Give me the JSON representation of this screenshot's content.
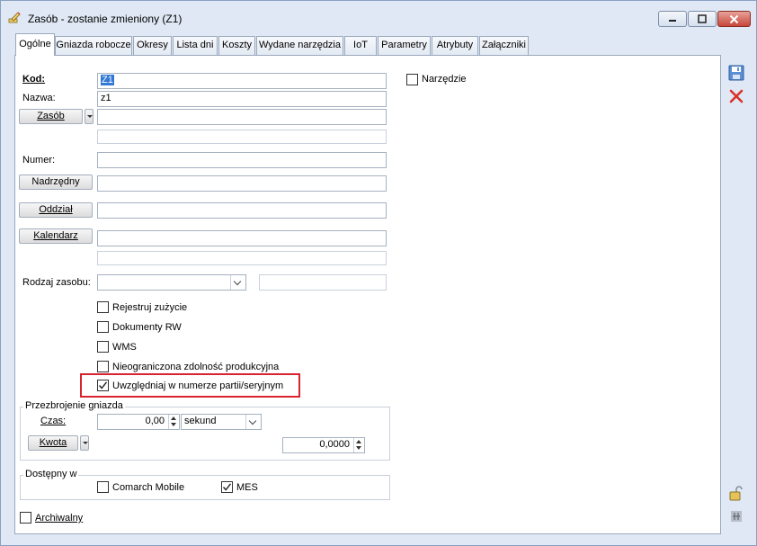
{
  "window": {
    "title": "Zasób - zostanie zmieniony  (Z1)",
    "minimize_glyph": "▬",
    "maximize_glyph": "□",
    "close_glyph": "✕"
  },
  "tabs": [
    {
      "label": "Ogólne"
    },
    {
      "label": "Gniazda robocze"
    },
    {
      "label": "Okresy"
    },
    {
      "label": "Lista dni"
    },
    {
      "label": "Koszty"
    },
    {
      "label": "Wydane narzędzia"
    },
    {
      "label": "IoT"
    },
    {
      "label": "Parametry"
    },
    {
      "label": "Atrybuty"
    },
    {
      "label": "Załączniki"
    }
  ],
  "form": {
    "kod_label": "Kod:",
    "kod_value": "Z1",
    "nazwa_label": "Nazwa:",
    "nazwa_value": "z1",
    "zasob_button": "Zasób",
    "numer_label": "Numer:",
    "nadrzedny_button": "Nadrzędny",
    "oddzial_button": "Oddział",
    "kalendarz_button": "Kalendarz",
    "rodzaj_label": "Rodzaj zasobu:",
    "narzedzie_label": "Narzędzie",
    "narzedzie_checked": false
  },
  "checkboxes": [
    {
      "label": "Rejestruj zużycie",
      "checked": false
    },
    {
      "label": "Dokumenty RW",
      "checked": false
    },
    {
      "label": "WMS",
      "checked": false
    },
    {
      "label": "Nieograniczona zdolność produkcyjna",
      "checked": false
    },
    {
      "label": "Uwzględniaj w numerze partii/seryjnym",
      "checked": true
    }
  ],
  "przezbrojenie": {
    "title": "Przezbrojenie gniazda",
    "czas_label": "Czas:",
    "czas_value": "0,00",
    "unit_value": "sekund",
    "kwota_button": "Kwota",
    "kwota_value": "0,0000"
  },
  "dostepny": {
    "title": "Dostępny w",
    "comarch_label": "Comarch Mobile",
    "comarch_checked": false,
    "mes_label": "MES",
    "mes_checked": true
  },
  "archiwalny_label": "Archiwalny",
  "archiwalny_checked": false,
  "colors": {
    "highlight": "#d9232e",
    "selection": "#3378d6"
  }
}
